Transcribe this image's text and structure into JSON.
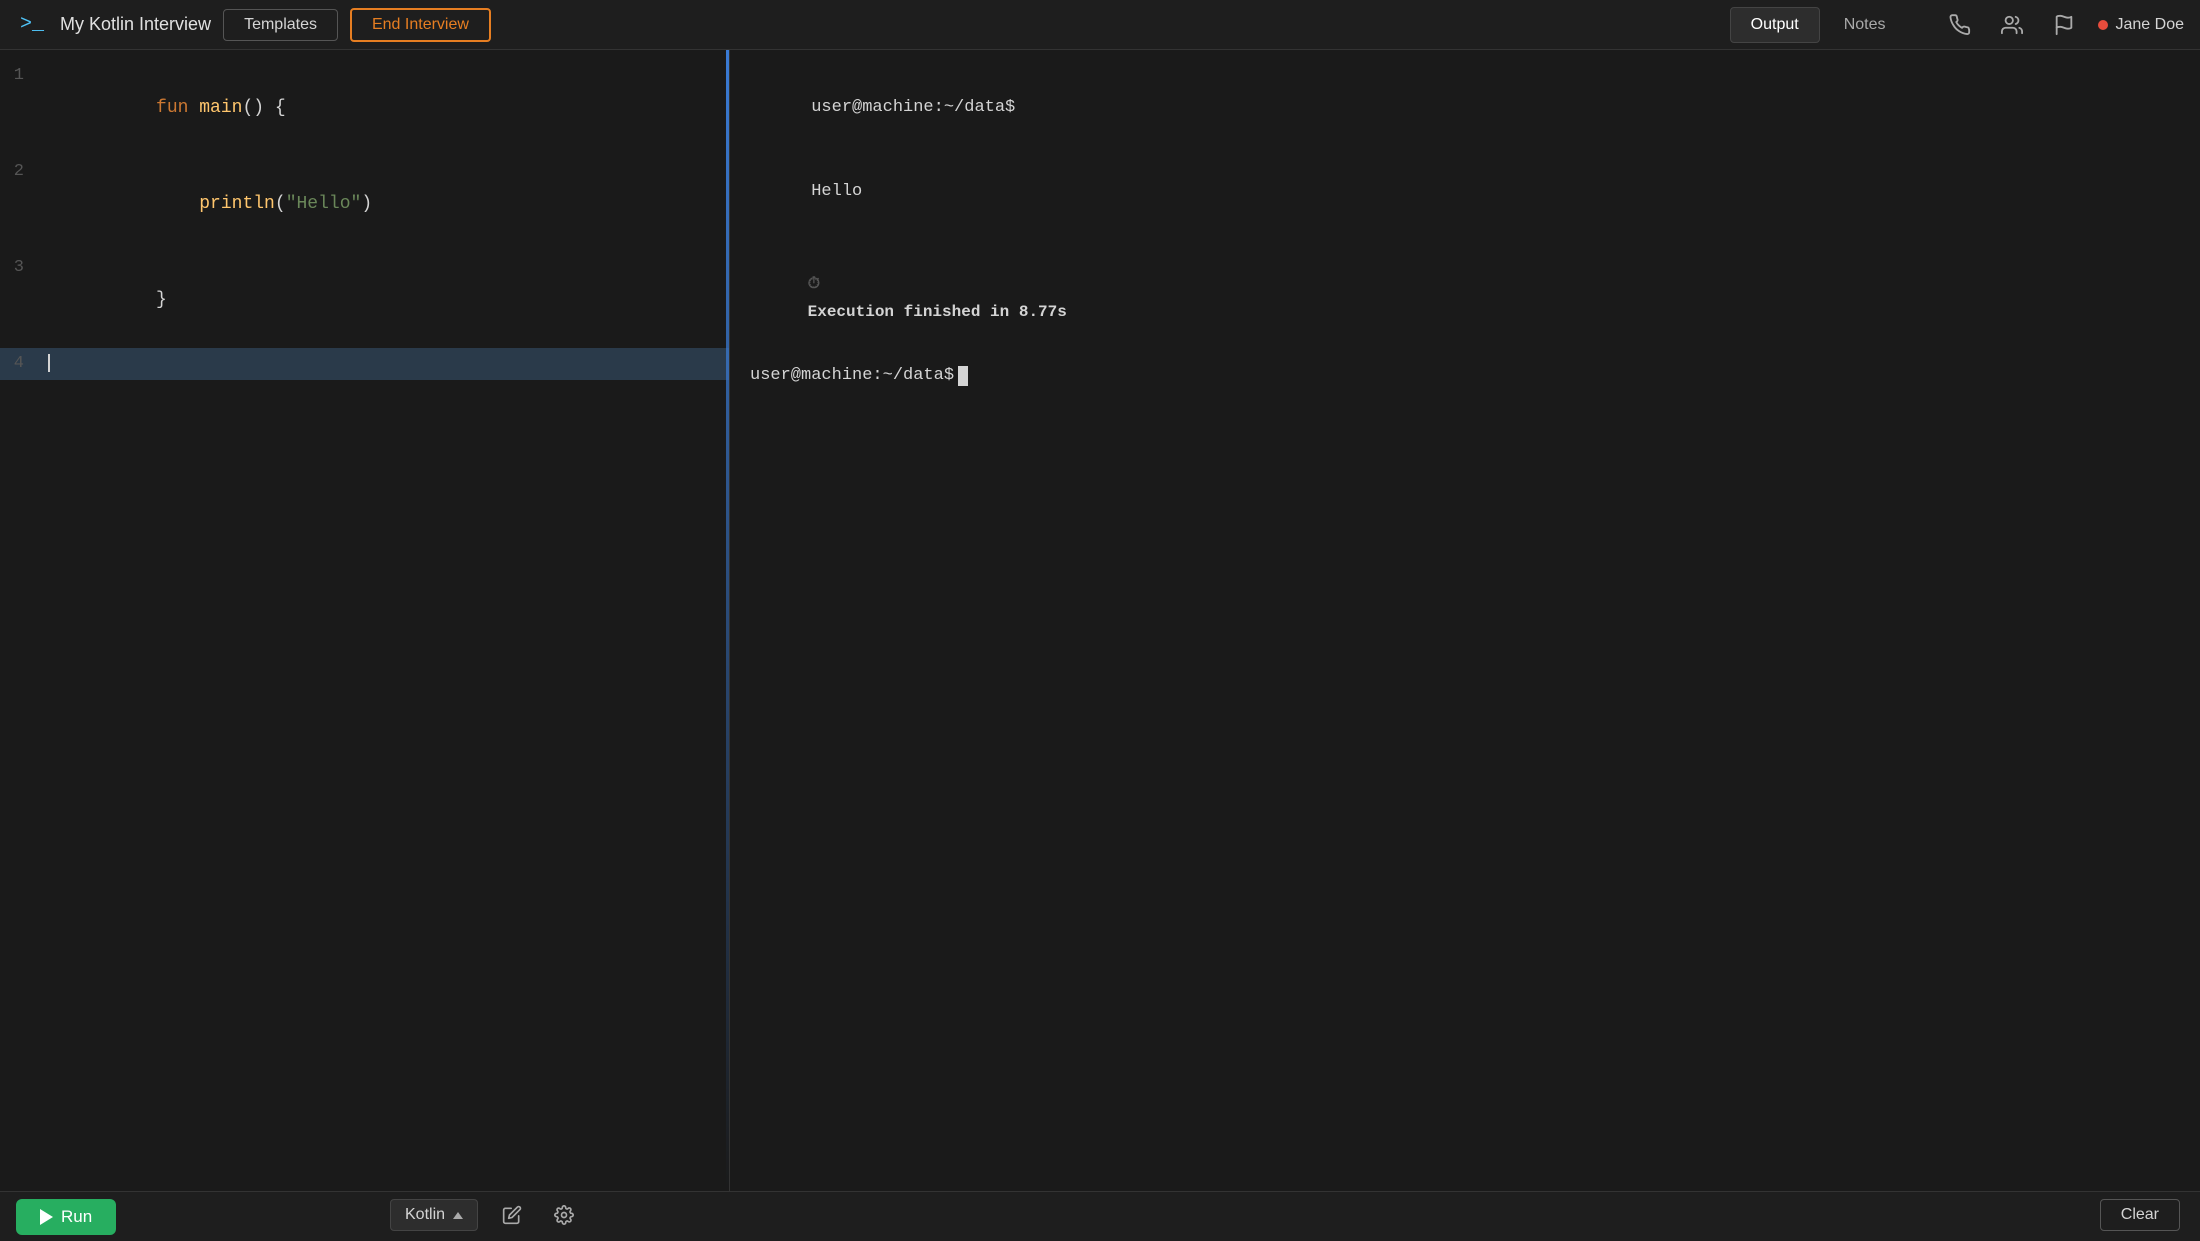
{
  "header": {
    "app_icon": ">_",
    "title": "My Kotlin Interview",
    "templates_label": "Templates",
    "end_interview_label": "End Interview",
    "output_tab_label": "Output",
    "notes_tab_label": "Notes",
    "active_tab": "output",
    "username": "Jane Doe",
    "status_color": "#e74c3c"
  },
  "editor": {
    "lines": [
      {
        "number": 1,
        "content": "fun main() {"
      },
      {
        "number": 2,
        "content": "    println(\"Hello\")"
      },
      {
        "number": 3,
        "content": "}"
      },
      {
        "number": 4,
        "content": ""
      }
    ]
  },
  "output": {
    "prompt1": "user@machine:~/data$",
    "hello_output": "Hello",
    "execution_text": "Execution finished in ",
    "execution_time": "8.77s",
    "prompt2": "user@machine:~/data$"
  },
  "toolbar": {
    "run_label": "Run",
    "language_label": "Kotlin",
    "clear_label": "Clear"
  }
}
